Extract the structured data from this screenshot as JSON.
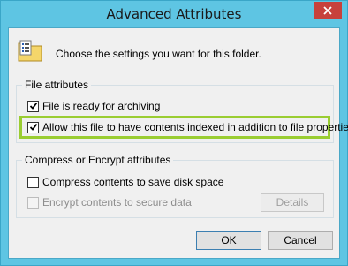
{
  "window": {
    "title": "Advanced Attributes",
    "close_icon": "close-icon",
    "close_color": "#c7413c"
  },
  "intro": {
    "icon": "folder-settings-icon",
    "text": "Choose the settings you want for this folder."
  },
  "file_attributes": {
    "legend": "File attributes",
    "archive": {
      "label": "File is ready for archiving",
      "checked": true
    },
    "index": {
      "label": "Allow this file to have contents indexed in addition to file properties",
      "checked": true
    },
    "highlight_color": "#9acd32"
  },
  "compress_encrypt": {
    "legend": "Compress or Encrypt attributes",
    "compress": {
      "label": "Compress contents to save disk space",
      "checked": false
    },
    "encrypt": {
      "label": "Encrypt contents to secure data",
      "checked": false,
      "disabled": true
    },
    "details_label": "Details"
  },
  "buttons": {
    "ok": "OK",
    "cancel": "Cancel"
  }
}
